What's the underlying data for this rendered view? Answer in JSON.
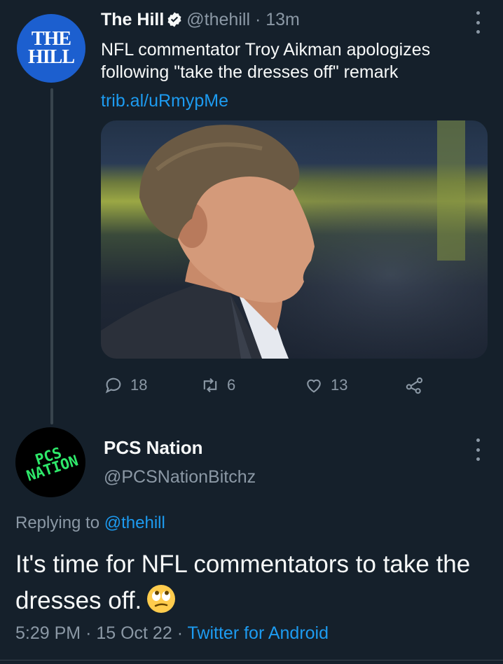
{
  "tweet1": {
    "author_name": "The Hill",
    "handle": "@thehill",
    "separator": "·",
    "time": "13m",
    "avatar_text_line1": "THE",
    "avatar_text_line2": "HILL",
    "text": "NFL commentator Troy Aikman apologizes following \"take the dresses off\" remark",
    "link": "trib.al/uRmypMe",
    "replies": "18",
    "retweets": "6",
    "likes": "13",
    "colors": {
      "avatar_bg": "#1c5fcf",
      "link": "#1d9bf0",
      "verified": "#f7f9f9"
    }
  },
  "tweet2": {
    "author_name": "PCS Nation",
    "handle": "@PCSNationBitchz",
    "avatar_text_line1": "PCS",
    "avatar_text_line2": "NATION",
    "replying_prefix": "Replying to",
    "replying_to": "@thehill",
    "text": "It's time for NFL commentators to take the dresses off.",
    "emoji": "face-with-rolling-eyes",
    "time": "5:29 PM",
    "date": "15 Oct 22",
    "dot": "·",
    "source": "Twitter for Android",
    "colors": {
      "avatar_text": "#2ee86a",
      "mention": "#1d9bf0"
    }
  },
  "icons": {
    "reply": "reply-icon",
    "retweet": "retweet-icon",
    "like": "heart-icon",
    "share": "share-icon",
    "more": "more-options-icon"
  },
  "theme": {
    "background": "#15202b",
    "text": "#f7f9f9",
    "secondary": "#8b98a5"
  }
}
